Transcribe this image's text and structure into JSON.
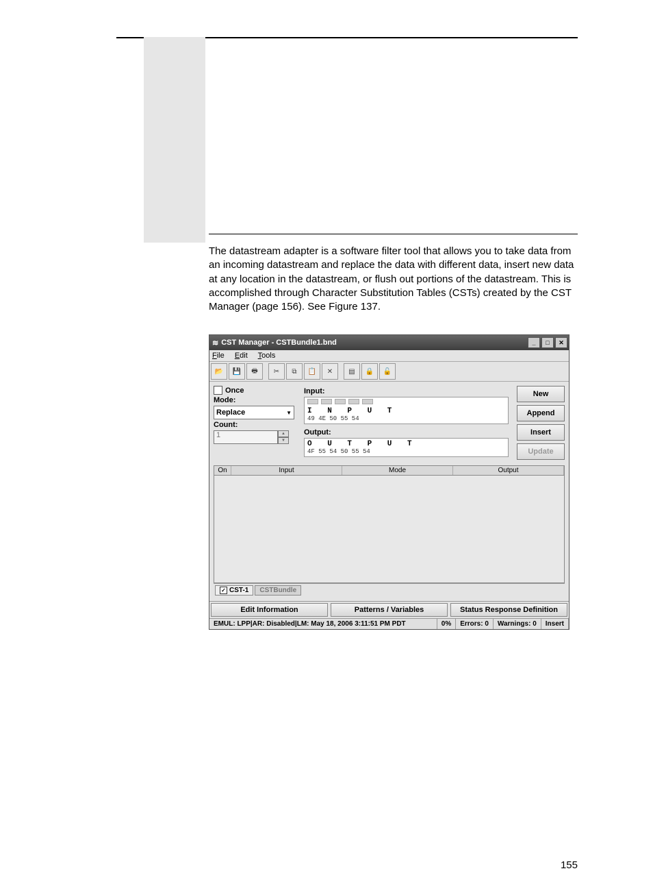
{
  "page": {
    "number": "155",
    "paragraph": "The datastream adapter is a software filter tool that allows you to take data from an incoming datastream and replace the data with different data, insert new data at any location in the datastream, or flush out portions of the datastream. This is accomplished through Character Substitution Tables (CSTs) created by the CST Manager (page 156). See Figure 137."
  },
  "window": {
    "title": "CST Manager - CSTBundle1.bnd",
    "menus": {
      "file": "File",
      "edit": "Edit",
      "tools": "Tools"
    },
    "toolbar_icons": [
      "open-icon",
      "save-icon",
      "print-icon",
      "cut-icon",
      "copy-icon",
      "paste-icon",
      "delete-icon",
      "tool-a-icon",
      "tool-b-icon",
      "tool-c-icon"
    ]
  },
  "controls": {
    "once_label": "Once",
    "once_checked": false,
    "mode_label": "Mode:",
    "mode_value": "Replace",
    "count_label": "Count:",
    "count_value": "1",
    "input_label": "Input:",
    "input_chars": "I N P U T",
    "input_hex": "49 4E 50 55 54",
    "output_label": "Output:",
    "output_chars": "O U T P U T",
    "output_hex": "4F 55 54 50 55 54",
    "buttons": {
      "new": "New",
      "append": "Append",
      "insert": "Insert",
      "update": "Update"
    }
  },
  "table": {
    "headers": {
      "on": "On",
      "input": "Input",
      "mode": "Mode",
      "output": "Output"
    }
  },
  "tabs": {
    "cst1": "CST-1",
    "bundle": "CSTBundle"
  },
  "panes": {
    "edit_info": "Edit Information",
    "patterns": "Patterns / Variables",
    "status_def": "Status Response Definition"
  },
  "status": {
    "left": "EMUL: LPP|AR: Disabled|LM: May 18, 2006 3:11:51 PM PDT",
    "percent": "0%",
    "errors": "Errors: 0",
    "warnings": "Warnings: 0",
    "mode": "Insert"
  }
}
